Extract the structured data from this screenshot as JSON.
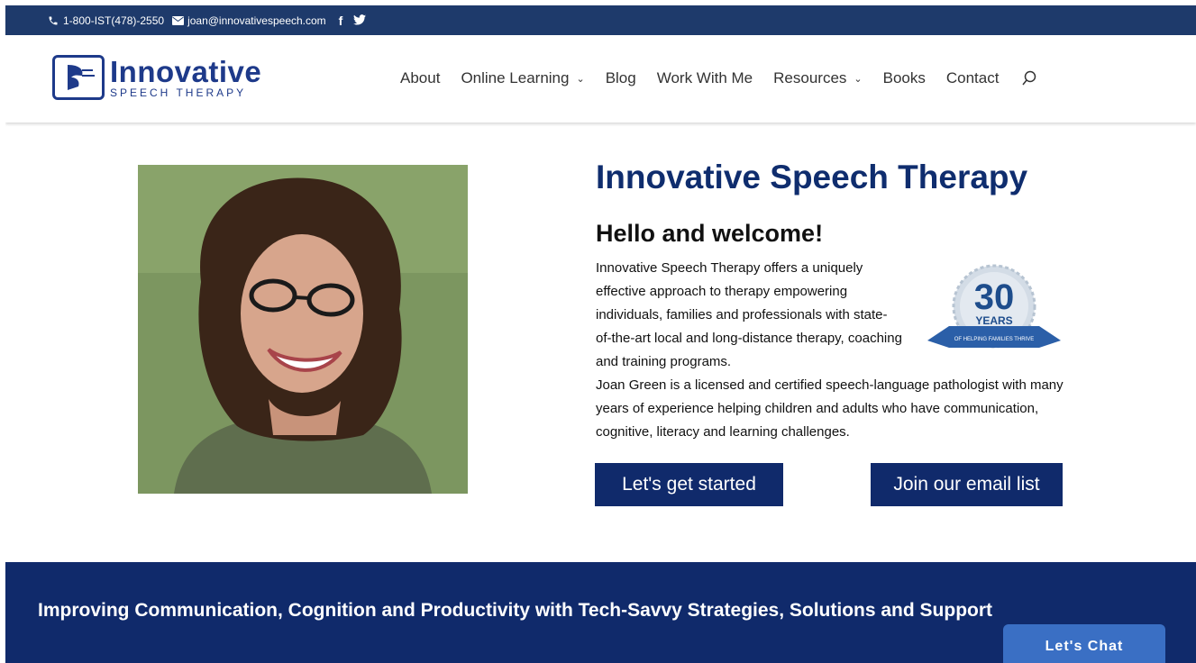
{
  "topbar": {
    "phone": "1-800-IST(478)-2550",
    "email": "joan@innovativespeech.com",
    "facebook_icon": "facebook-icon",
    "twitter_icon": "twitter-icon"
  },
  "logo": {
    "main": "Innovative",
    "sub": "SPEECH THERAPY"
  },
  "nav": {
    "items": [
      {
        "label": "About"
      },
      {
        "label": "Online Learning",
        "dropdown": true
      },
      {
        "label": "Blog"
      },
      {
        "label": "Work With Me"
      },
      {
        "label": "Resources",
        "dropdown": true
      },
      {
        "label": "Books"
      },
      {
        "label": "Contact"
      }
    ],
    "search_icon": "search-icon"
  },
  "hero": {
    "title": "Innovative Speech Therapy",
    "subtitle": "Hello and welcome!",
    "para1": "Innovative Speech Therapy offers a uniquely effective approach to therapy empowering individuals, families and professionals with state-of-the-art local and long-distance therapy, coaching and training programs.",
    "para2": "Joan Green is a licensed and certified speech-language pathologist with many years of experience helping children and adults who have communication, cognitive, literacy and learning challenges.",
    "badge": {
      "number": "30",
      "word": "YEARS",
      "ribbon": "OF HELPING FAMILIES THRIVE"
    },
    "btn_start": "Let's get started",
    "btn_email": "Join our email list"
  },
  "banner": {
    "text": "Improving Communication, Cognition and Productivity with Tech-Savvy Strategies, Solutions and Support"
  },
  "chat": {
    "label": "Let's Chat"
  },
  "colors": {
    "topbar": "#1e3a6b",
    "brand_navy": "#102a6b",
    "chat_blue": "#3a6fc4"
  }
}
